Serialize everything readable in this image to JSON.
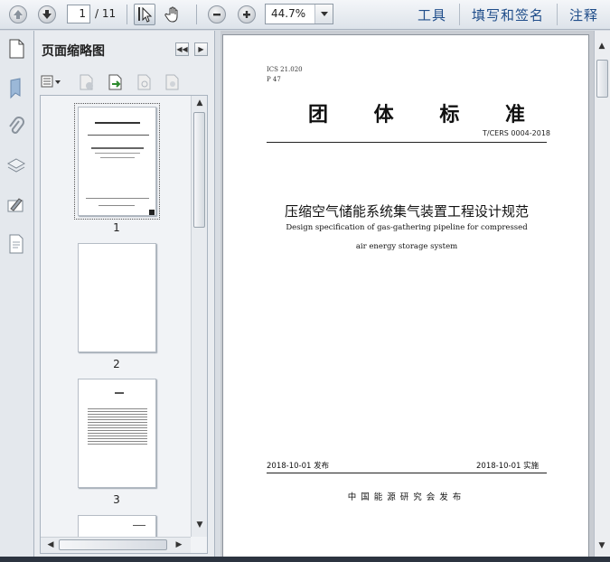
{
  "toolbar": {
    "current_page": "1",
    "total_pages": "/ 11",
    "zoom": "44.7%",
    "menu": [
      "工具",
      "填写和签名",
      "注释"
    ]
  },
  "sidebar": {
    "title": "页面缩略图",
    "thumbnails": [
      "1",
      "2",
      "3"
    ]
  },
  "document": {
    "ics": "ICS 21.020",
    "ccs": "P 47",
    "title_chars": [
      "团",
      "体",
      "标",
      "准"
    ],
    "code": "T/CERS 0004-2018",
    "cn_title": "压缩空气储能系统集气装置工程设计规范",
    "en_title_line1": "Design specification of gas-gathering pipeline for compressed",
    "en_title_line2": "air energy storage system",
    "issue_date": "2018-10-01 发布",
    "impl_date": "2018-10-01 实施",
    "issuer": "中国能源研究会发布"
  },
  "colors": {
    "menu_link": "#1f4d8a",
    "toolbar_bg": "#e6eaef",
    "panel_bg": "#e9ecf0"
  }
}
